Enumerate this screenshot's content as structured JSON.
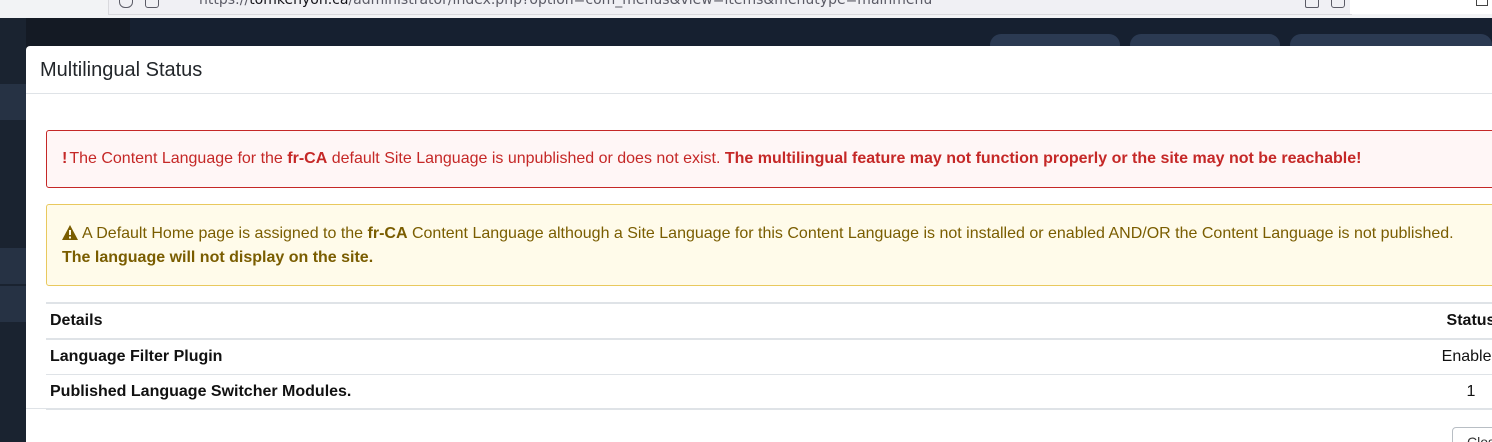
{
  "browser": {
    "url_scheme": "https://",
    "url_host": "tomkenyon.ca",
    "url_path": "/administrator/index.php?option=com_menus&view=items&menutype=mainmenu"
  },
  "modal": {
    "title": "Multilingual Status",
    "danger_alert": {
      "mark": "!",
      "text_1": "The Content Language for the ",
      "lang": "fr-CA",
      "text_2": " default Site Language is unpublished or does not exist. ",
      "bold": "The multilingual feature may not function properly or the site may not be reachable!"
    },
    "warning_alert": {
      "text_1": "A Default Home page is assigned to the ",
      "lang": "fr-CA",
      "text_2": " Content Language although a Site Language for this Content Language is not installed or enabled AND/OR the Content Language is not published. ",
      "bold": "The language will not display on the site."
    },
    "table": {
      "headers": {
        "details": "Details",
        "status": "Status"
      },
      "rows": [
        {
          "details": "Language Filter Plugin",
          "status": "Enabled"
        },
        {
          "details": "Published Language Switcher Modules.",
          "status": "1"
        }
      ]
    },
    "footer": {
      "close_label": "Close"
    }
  },
  "colors": {
    "danger": "#c52827",
    "warning_text": "#7a5d00",
    "warning_border": "#e9c95e",
    "admin_dark": "#141a24"
  },
  "icons": [
    "warning-icon",
    "lock-icon",
    "star-icon"
  ]
}
